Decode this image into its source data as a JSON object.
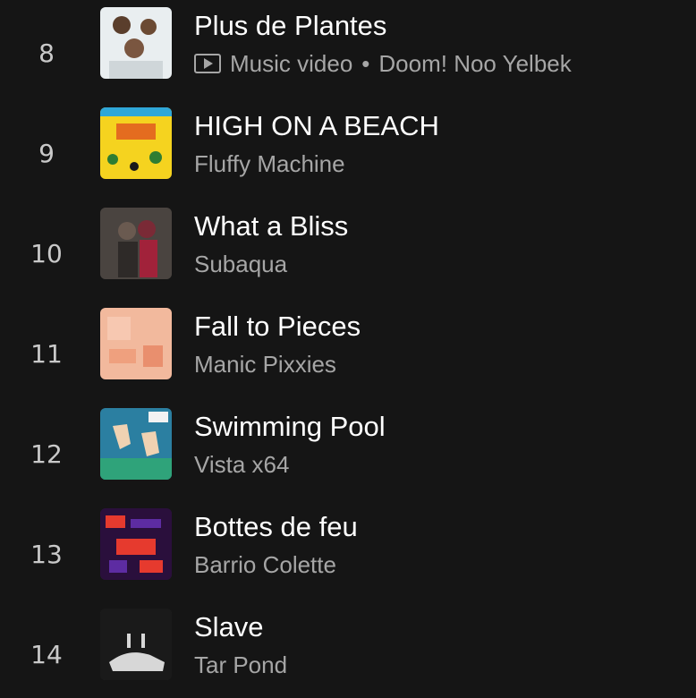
{
  "tracks": [
    {
      "index": "8",
      "title": "Plus de Plantes",
      "type": "Music video",
      "artist": "Doom! Noo Yelbek",
      "type_icon": "play-video-icon",
      "separator": "•",
      "artwork_colors": [
        "#e9eef0",
        "#cfd6d9"
      ]
    },
    {
      "index": "9",
      "title": "HIGH ON A BEACH",
      "artist": "Fluffy Machine",
      "artwork_colors": [
        "#f5d31f",
        "#2fa7d8"
      ]
    },
    {
      "index": "10",
      "title": "What a Bliss",
      "artist": "Subaqua",
      "artwork_colors": [
        "#5a4f4a",
        "#a1223a"
      ]
    },
    {
      "index": "11",
      "title": "Fall to Pieces",
      "artist": "Manic Pixxies",
      "artwork_colors": [
        "#f2b99d",
        "#efa07e"
      ]
    },
    {
      "index": "12",
      "title": "Swimming Pool",
      "artist": "Vista x64",
      "artwork_colors": [
        "#2b7fa1",
        "#f0d2b2"
      ]
    },
    {
      "index": "13",
      "title": "Bottes de feu",
      "artist": "Barrio Colette",
      "artwork_colors": [
        "#5d2ca2",
        "#e63a2e"
      ]
    },
    {
      "index": "14",
      "title": "Slave",
      "artist": "Tar Pond",
      "artwork_colors": [
        "#1a1a1a",
        "#d7d7d7"
      ]
    }
  ]
}
